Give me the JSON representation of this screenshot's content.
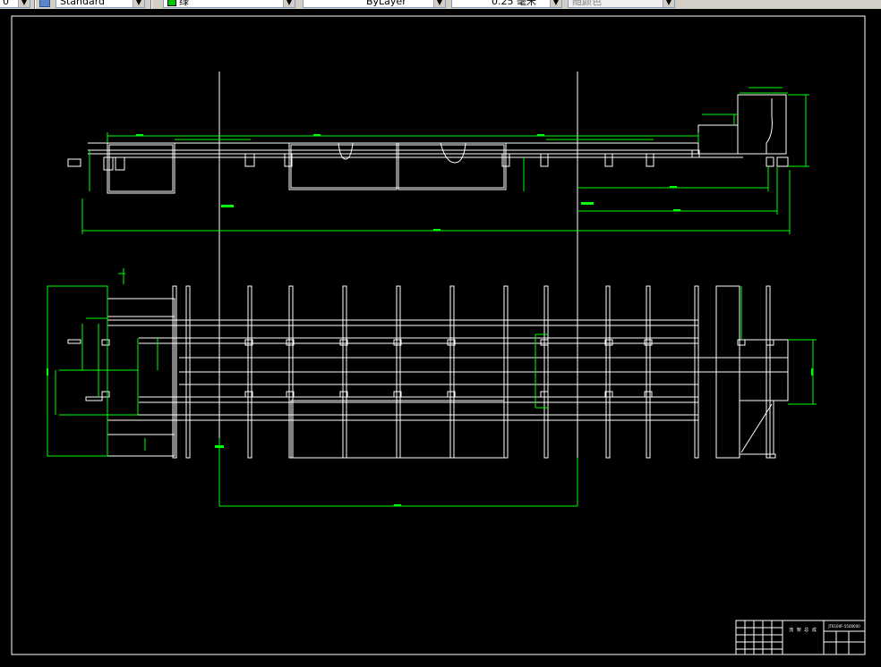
{
  "toolbar": {
    "linetype_combo": "0",
    "textstyle_combo": "Standard",
    "color_combo": "绿",
    "linetype_control": "ByLayer",
    "lineweight_control": "0.25 毫米",
    "plotstyle_control": "随颜色"
  },
  "drawing": {
    "background": "#000000",
    "border_color": "#ffffff",
    "dimension_color": "#00ff00",
    "geometry_color": "#ffffff"
  },
  "title_block": {
    "drawing_title": "流 架 总 成",
    "drawing_code": "JT6100F-5500000"
  }
}
